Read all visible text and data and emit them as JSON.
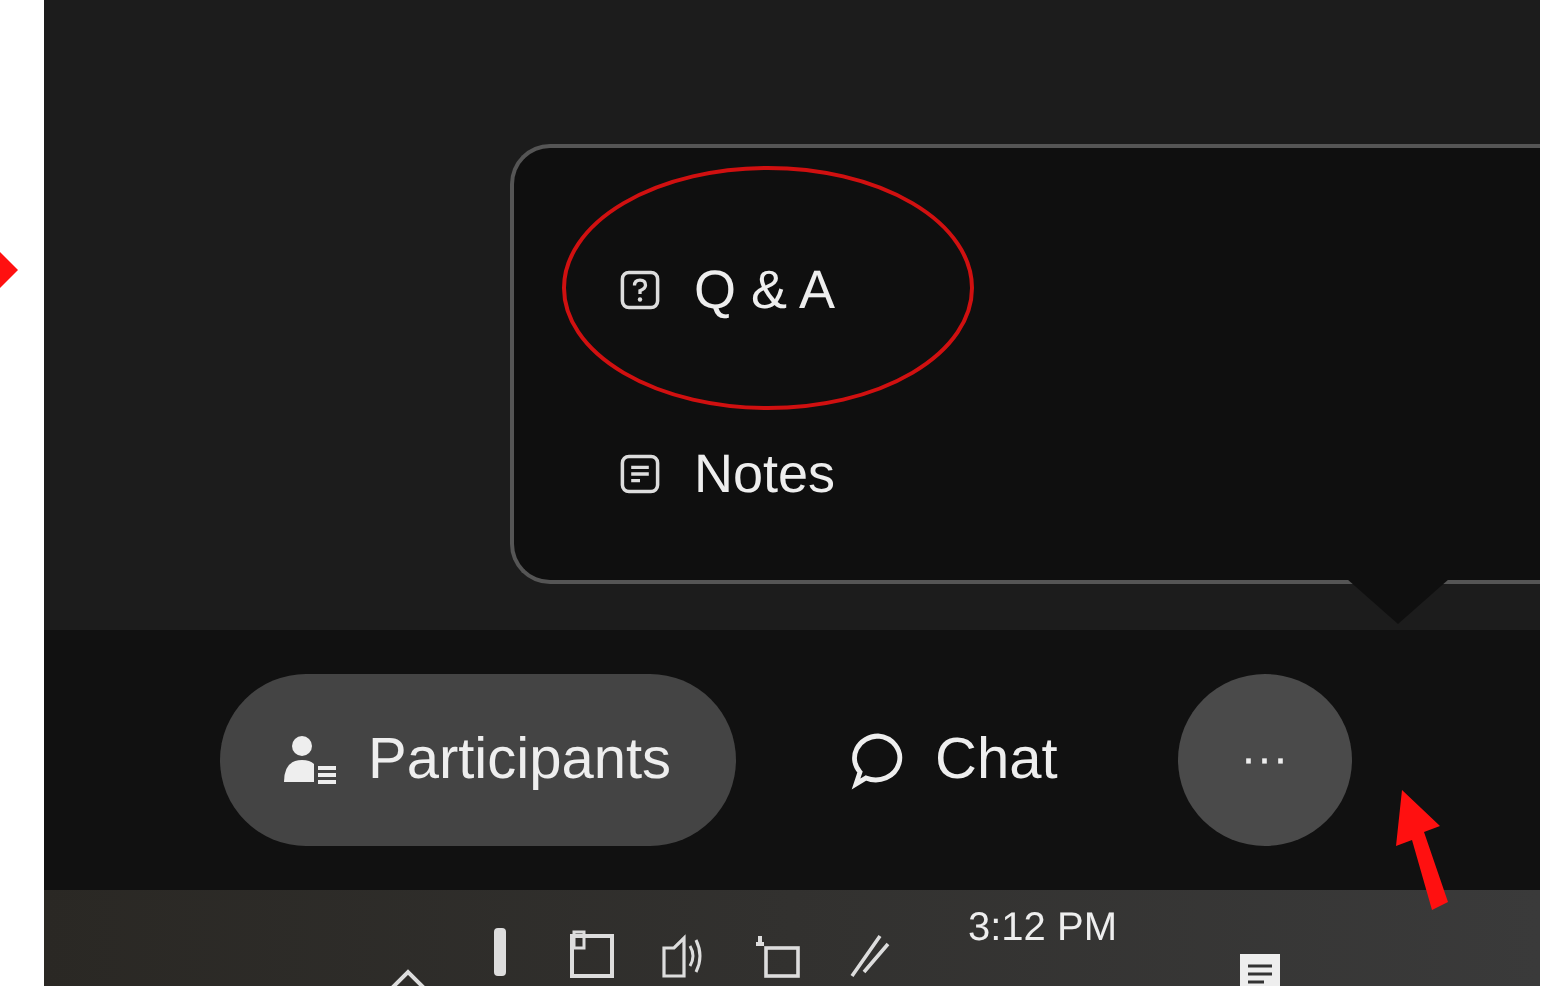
{
  "menu": {
    "items": [
      {
        "label": "Q & A"
      },
      {
        "label": "Notes"
      }
    ]
  },
  "toolbar": {
    "buttons": [
      {
        "label": "Participants",
        "kind": "pill"
      },
      {
        "label": "Chat",
        "kind": "plain"
      },
      {
        "label": "···",
        "kind": "round"
      }
    ]
  },
  "taskbar": {
    "time": "3:12 PM"
  }
}
